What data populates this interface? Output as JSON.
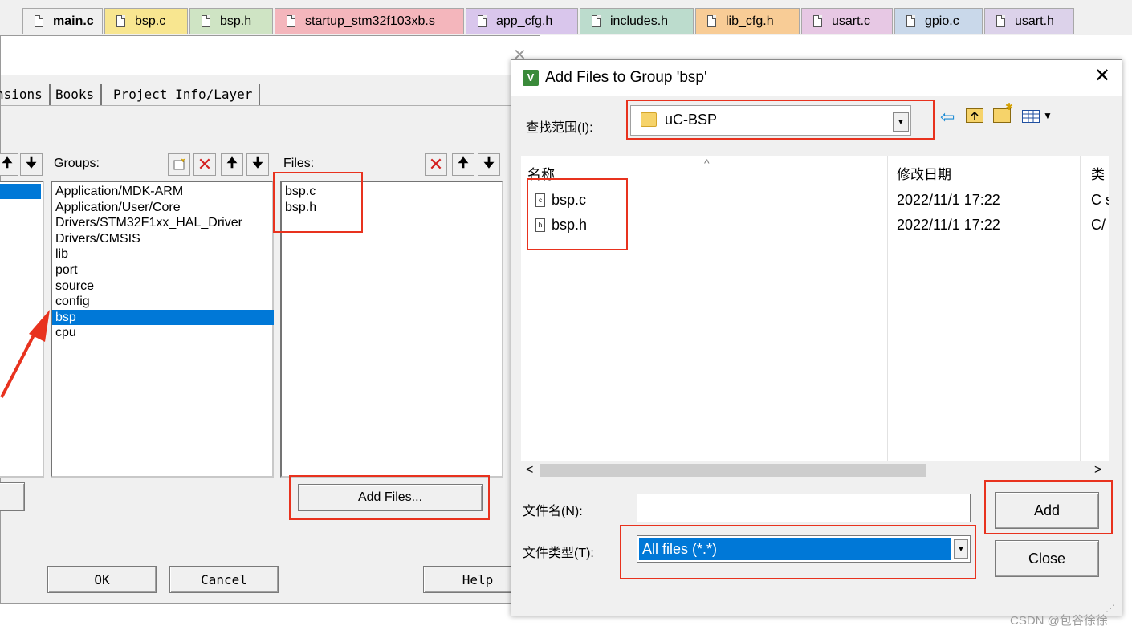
{
  "editor_tabs": [
    {
      "label": "main.c",
      "color": "#f0f0f0",
      "active": true
    },
    {
      "label": "bsp.c",
      "color": "#f8e690"
    },
    {
      "label": "bsp.h",
      "color": "#cfe4c4"
    },
    {
      "label": "startup_stm32f103xb.s",
      "color": "#f4b6bc"
    },
    {
      "label": "app_cfg.h",
      "color": "#d9c6ec"
    },
    {
      "label": "includes.h",
      "color": "#bcdccd"
    },
    {
      "label": "lib_cfg.h",
      "color": "#f8cc96"
    },
    {
      "label": "usart.c",
      "color": "#e7c8e4"
    },
    {
      "label": "gpio.c",
      "color": "#c9d8ea"
    },
    {
      "label": "usart.h",
      "color": "#dcd2ea"
    }
  ],
  "project_dialog": {
    "tabs": [
      "nsions",
      "Books",
      "Project Info/Layer"
    ],
    "groups_label": "Groups:",
    "files_label": "Files:",
    "groups": [
      "Application/MDK-ARM",
      "Application/User/Core",
      "Drivers/STM32F1xx_HAL_Driver",
      "Drivers/CMSIS",
      "lib",
      "port",
      "source",
      "config",
      "bsp",
      "cpu"
    ],
    "selected_group": "bsp",
    "files": [
      "bsp.c",
      "bsp.h"
    ],
    "add_files_label": "Add Files...",
    "ok_label": "OK",
    "cancel_label": "Cancel",
    "help_label": "Help"
  },
  "file_dialog": {
    "title": "Add Files to Group 'bsp'",
    "lookin_label": "查找范围(I):",
    "lookin_value": "uC-BSP",
    "columns": {
      "name": "名称",
      "date": "修改日期",
      "type": "类"
    },
    "files": [
      {
        "name": "bsp.c",
        "date": "2022/11/1 17:22",
        "type": "C s",
        "icon": "c-source-file-icon"
      },
      {
        "name": "bsp.h",
        "date": "2022/11/1 17:22",
        "type": "C/",
        "icon": "header-file-icon"
      }
    ],
    "filename_label": "文件名(N):",
    "filename_value": "",
    "filetype_label": "文件类型(T):",
    "filetype_value": "All files (*.*)",
    "add_label": "Add",
    "close_label": "Close"
  },
  "watermark": "CSDN @包谷徐徐",
  "colors": {
    "highlight_red": "#e8321e",
    "selection_blue": "#0078d7",
    "arrow_red": "#e8321e"
  }
}
